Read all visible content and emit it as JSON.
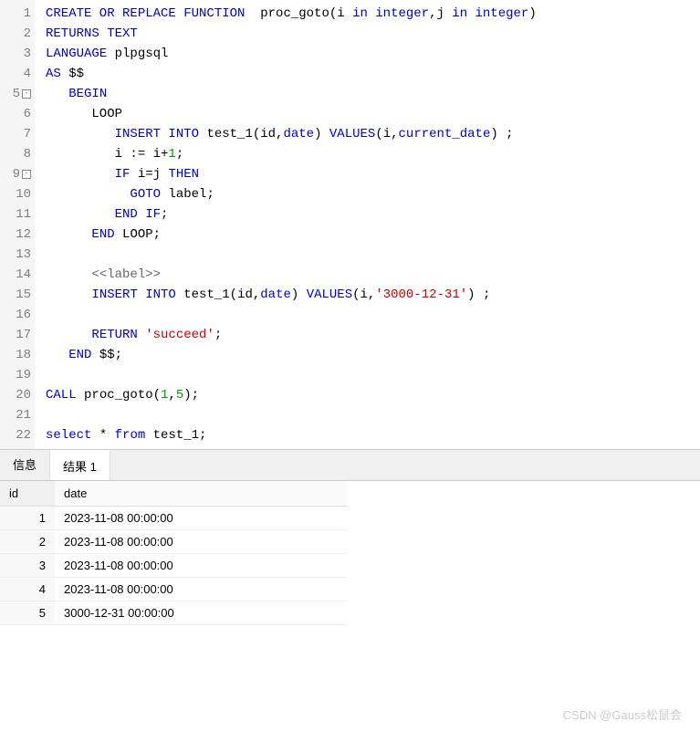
{
  "code": {
    "lines": [
      {
        "n": 1,
        "fold": "",
        "tokens": [
          [
            "kw",
            "CREATE OR REPLACE FUNCTION"
          ],
          [
            "txt",
            "  proc_goto(i "
          ],
          [
            "kw",
            "in integer"
          ],
          [
            "txt",
            ",j "
          ],
          [
            "kw",
            "in integer"
          ],
          [
            "txt",
            ")"
          ]
        ]
      },
      {
        "n": 2,
        "fold": "",
        "tokens": [
          [
            "kw",
            "RETURNS TEXT"
          ]
        ]
      },
      {
        "n": 3,
        "fold": "",
        "tokens": [
          [
            "kw",
            "LANGUAGE"
          ],
          [
            "txt",
            " plpgsql"
          ]
        ]
      },
      {
        "n": 4,
        "fold": "",
        "tokens": [
          [
            "kw",
            "AS"
          ],
          [
            "txt",
            " $$"
          ]
        ]
      },
      {
        "n": 5,
        "fold": "-",
        "tokens": [
          [
            "txt",
            "   "
          ],
          [
            "kw",
            "BEGIN"
          ]
        ]
      },
      {
        "n": 6,
        "fold": "",
        "tokens": [
          [
            "txt",
            "      LOOP"
          ]
        ]
      },
      {
        "n": 7,
        "fold": "",
        "tokens": [
          [
            "txt",
            "         "
          ],
          [
            "kw",
            "INSERT INTO"
          ],
          [
            "txt",
            " test_1(id,"
          ],
          [
            "kw",
            "date"
          ],
          [
            "txt",
            ") "
          ],
          [
            "kw",
            "VALUES"
          ],
          [
            "txt",
            "(i,"
          ],
          [
            "kw",
            "current_date"
          ],
          [
            "txt",
            ") ;"
          ]
        ]
      },
      {
        "n": 8,
        "fold": "",
        "tokens": [
          [
            "txt",
            "         i := i+"
          ],
          [
            "num",
            "1"
          ],
          [
            "txt",
            ";"
          ]
        ]
      },
      {
        "n": 9,
        "fold": "-",
        "tokens": [
          [
            "txt",
            "         "
          ],
          [
            "kw",
            "IF"
          ],
          [
            "txt",
            " i=j "
          ],
          [
            "kw",
            "THEN"
          ]
        ]
      },
      {
        "n": 10,
        "fold": "",
        "tokens": [
          [
            "txt",
            "           "
          ],
          [
            "kw",
            "GOTO"
          ],
          [
            "txt",
            " label;"
          ]
        ]
      },
      {
        "n": 11,
        "fold": "",
        "tokens": [
          [
            "txt",
            "         "
          ],
          [
            "kw",
            "END IF"
          ],
          [
            "txt",
            ";"
          ]
        ]
      },
      {
        "n": 12,
        "fold": "",
        "tokens": [
          [
            "txt",
            "      "
          ],
          [
            "kw",
            "END"
          ],
          [
            "txt",
            " LOOP;"
          ]
        ]
      },
      {
        "n": 13,
        "fold": "",
        "tokens": []
      },
      {
        "n": 14,
        "fold": "",
        "tokens": [
          [
            "txt",
            "      "
          ],
          [
            "label",
            "<<label>>"
          ]
        ]
      },
      {
        "n": 15,
        "fold": "",
        "tokens": [
          [
            "txt",
            "      "
          ],
          [
            "kw",
            "INSERT INTO"
          ],
          [
            "txt",
            " test_1(id,"
          ],
          [
            "kw",
            "date"
          ],
          [
            "txt",
            ") "
          ],
          [
            "kw",
            "VALUES"
          ],
          [
            "txt",
            "(i,"
          ],
          [
            "str",
            "'3000-12-31'"
          ],
          [
            "txt",
            ") ;"
          ]
        ]
      },
      {
        "n": 16,
        "fold": "",
        "tokens": []
      },
      {
        "n": 17,
        "fold": "",
        "tokens": [
          [
            "txt",
            "      "
          ],
          [
            "kw",
            "RETURN"
          ],
          [
            "txt",
            " "
          ],
          [
            "str",
            "'succeed'"
          ],
          [
            "txt",
            ";"
          ]
        ]
      },
      {
        "n": 18,
        "fold": "",
        "tokens": [
          [
            "txt",
            "   "
          ],
          [
            "kw",
            "END"
          ],
          [
            "txt",
            " $$;"
          ]
        ]
      },
      {
        "n": 19,
        "fold": "",
        "tokens": []
      },
      {
        "n": 20,
        "fold": "",
        "tokens": [
          [
            "kw",
            "CALL"
          ],
          [
            "txt",
            " proc_goto("
          ],
          [
            "num",
            "1"
          ],
          [
            "txt",
            ","
          ],
          [
            "num",
            "5"
          ],
          [
            "txt",
            ");"
          ]
        ]
      },
      {
        "n": 21,
        "fold": "",
        "tokens": []
      },
      {
        "n": 22,
        "fold": "",
        "tokens": [
          [
            "kw",
            "select"
          ],
          [
            "txt",
            " * "
          ],
          [
            "kw",
            "from"
          ],
          [
            "txt",
            " test_1;"
          ]
        ]
      }
    ]
  },
  "tabs": {
    "tab1": "信息",
    "tab2": "结果 1"
  },
  "results": {
    "headers": [
      "id",
      "date"
    ],
    "rows": [
      [
        "1",
        "2023-11-08 00:00:00"
      ],
      [
        "2",
        "2023-11-08 00:00:00"
      ],
      [
        "3",
        "2023-11-08 00:00:00"
      ],
      [
        "4",
        "2023-11-08 00:00:00"
      ],
      [
        "5",
        "3000-12-31 00:00:00"
      ]
    ]
  },
  "watermark": "CSDN @Gauss松鼠会"
}
